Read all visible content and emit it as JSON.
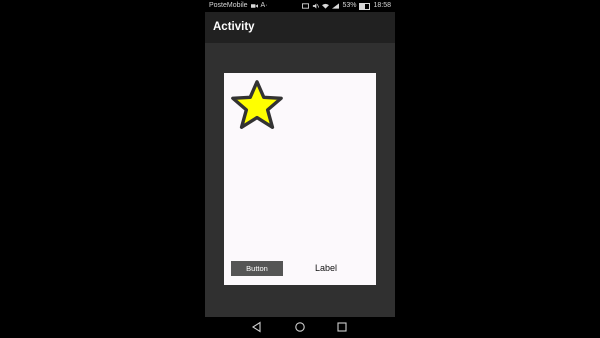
{
  "status": {
    "carrier": "PosteMobile",
    "extra": "A·",
    "battery": "53%",
    "time": "18:58"
  },
  "appbar": {
    "title": "Activity"
  },
  "card": {
    "button_label": "Button",
    "label_text": "Label",
    "star_icon": "star-icon",
    "star_color": "#ffff00"
  },
  "navbar": {
    "back": "back-icon",
    "home": "home-icon",
    "recents": "recents-icon"
  }
}
